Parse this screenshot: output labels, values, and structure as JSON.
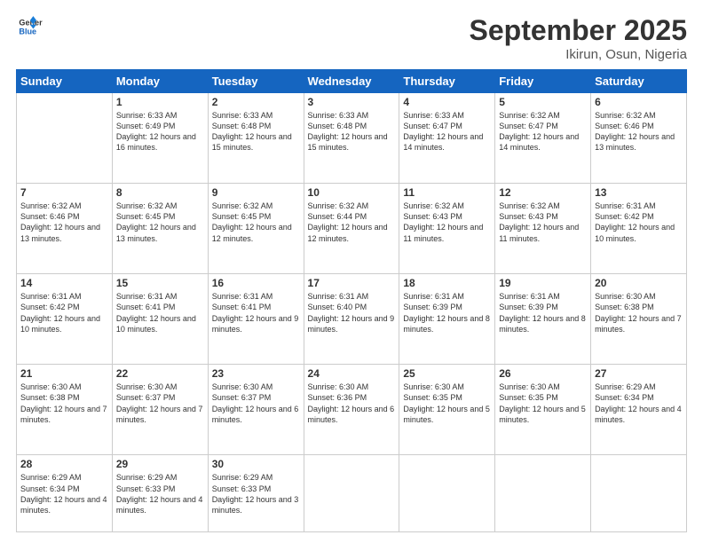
{
  "header": {
    "logo": {
      "line1": "General",
      "line2": "Blue"
    },
    "title": "September 2025",
    "location": "Ikirun, Osun, Nigeria"
  },
  "columns": [
    "Sunday",
    "Monday",
    "Tuesday",
    "Wednesday",
    "Thursday",
    "Friday",
    "Saturday"
  ],
  "weeks": [
    [
      {
        "day": "",
        "sunrise": "",
        "sunset": "",
        "daylight": ""
      },
      {
        "day": "1",
        "sunrise": "Sunrise: 6:33 AM",
        "sunset": "Sunset: 6:49 PM",
        "daylight": "Daylight: 12 hours and 16 minutes."
      },
      {
        "day": "2",
        "sunrise": "Sunrise: 6:33 AM",
        "sunset": "Sunset: 6:48 PM",
        "daylight": "Daylight: 12 hours and 15 minutes."
      },
      {
        "day": "3",
        "sunrise": "Sunrise: 6:33 AM",
        "sunset": "Sunset: 6:48 PM",
        "daylight": "Daylight: 12 hours and 15 minutes."
      },
      {
        "day": "4",
        "sunrise": "Sunrise: 6:33 AM",
        "sunset": "Sunset: 6:47 PM",
        "daylight": "Daylight: 12 hours and 14 minutes."
      },
      {
        "day": "5",
        "sunrise": "Sunrise: 6:32 AM",
        "sunset": "Sunset: 6:47 PM",
        "daylight": "Daylight: 12 hours and 14 minutes."
      },
      {
        "day": "6",
        "sunrise": "Sunrise: 6:32 AM",
        "sunset": "Sunset: 6:46 PM",
        "daylight": "Daylight: 12 hours and 13 minutes."
      }
    ],
    [
      {
        "day": "7",
        "sunrise": "Sunrise: 6:32 AM",
        "sunset": "Sunset: 6:46 PM",
        "daylight": "Daylight: 12 hours and 13 minutes."
      },
      {
        "day": "8",
        "sunrise": "Sunrise: 6:32 AM",
        "sunset": "Sunset: 6:45 PM",
        "daylight": "Daylight: 12 hours and 13 minutes."
      },
      {
        "day": "9",
        "sunrise": "Sunrise: 6:32 AM",
        "sunset": "Sunset: 6:45 PM",
        "daylight": "Daylight: 12 hours and 12 minutes."
      },
      {
        "day": "10",
        "sunrise": "Sunrise: 6:32 AM",
        "sunset": "Sunset: 6:44 PM",
        "daylight": "Daylight: 12 hours and 12 minutes."
      },
      {
        "day": "11",
        "sunrise": "Sunrise: 6:32 AM",
        "sunset": "Sunset: 6:43 PM",
        "daylight": "Daylight: 12 hours and 11 minutes."
      },
      {
        "day": "12",
        "sunrise": "Sunrise: 6:32 AM",
        "sunset": "Sunset: 6:43 PM",
        "daylight": "Daylight: 12 hours and 11 minutes."
      },
      {
        "day": "13",
        "sunrise": "Sunrise: 6:31 AM",
        "sunset": "Sunset: 6:42 PM",
        "daylight": "Daylight: 12 hours and 10 minutes."
      }
    ],
    [
      {
        "day": "14",
        "sunrise": "Sunrise: 6:31 AM",
        "sunset": "Sunset: 6:42 PM",
        "daylight": "Daylight: 12 hours and 10 minutes."
      },
      {
        "day": "15",
        "sunrise": "Sunrise: 6:31 AM",
        "sunset": "Sunset: 6:41 PM",
        "daylight": "Daylight: 12 hours and 10 minutes."
      },
      {
        "day": "16",
        "sunrise": "Sunrise: 6:31 AM",
        "sunset": "Sunset: 6:41 PM",
        "daylight": "Daylight: 12 hours and 9 minutes."
      },
      {
        "day": "17",
        "sunrise": "Sunrise: 6:31 AM",
        "sunset": "Sunset: 6:40 PM",
        "daylight": "Daylight: 12 hours and 9 minutes."
      },
      {
        "day": "18",
        "sunrise": "Sunrise: 6:31 AM",
        "sunset": "Sunset: 6:39 PM",
        "daylight": "Daylight: 12 hours and 8 minutes."
      },
      {
        "day": "19",
        "sunrise": "Sunrise: 6:31 AM",
        "sunset": "Sunset: 6:39 PM",
        "daylight": "Daylight: 12 hours and 8 minutes."
      },
      {
        "day": "20",
        "sunrise": "Sunrise: 6:30 AM",
        "sunset": "Sunset: 6:38 PM",
        "daylight": "Daylight: 12 hours and 7 minutes."
      }
    ],
    [
      {
        "day": "21",
        "sunrise": "Sunrise: 6:30 AM",
        "sunset": "Sunset: 6:38 PM",
        "daylight": "Daylight: 12 hours and 7 minutes."
      },
      {
        "day": "22",
        "sunrise": "Sunrise: 6:30 AM",
        "sunset": "Sunset: 6:37 PM",
        "daylight": "Daylight: 12 hours and 7 minutes."
      },
      {
        "day": "23",
        "sunrise": "Sunrise: 6:30 AM",
        "sunset": "Sunset: 6:37 PM",
        "daylight": "Daylight: 12 hours and 6 minutes."
      },
      {
        "day": "24",
        "sunrise": "Sunrise: 6:30 AM",
        "sunset": "Sunset: 6:36 PM",
        "daylight": "Daylight: 12 hours and 6 minutes."
      },
      {
        "day": "25",
        "sunrise": "Sunrise: 6:30 AM",
        "sunset": "Sunset: 6:35 PM",
        "daylight": "Daylight: 12 hours and 5 minutes."
      },
      {
        "day": "26",
        "sunrise": "Sunrise: 6:30 AM",
        "sunset": "Sunset: 6:35 PM",
        "daylight": "Daylight: 12 hours and 5 minutes."
      },
      {
        "day": "27",
        "sunrise": "Sunrise: 6:29 AM",
        "sunset": "Sunset: 6:34 PM",
        "daylight": "Daylight: 12 hours and 4 minutes."
      }
    ],
    [
      {
        "day": "28",
        "sunrise": "Sunrise: 6:29 AM",
        "sunset": "Sunset: 6:34 PM",
        "daylight": "Daylight: 12 hours and 4 minutes."
      },
      {
        "day": "29",
        "sunrise": "Sunrise: 6:29 AM",
        "sunset": "Sunset: 6:33 PM",
        "daylight": "Daylight: 12 hours and 4 minutes."
      },
      {
        "day": "30",
        "sunrise": "Sunrise: 6:29 AM",
        "sunset": "Sunset: 6:33 PM",
        "daylight": "Daylight: 12 hours and 3 minutes."
      },
      {
        "day": "",
        "sunrise": "",
        "sunset": "",
        "daylight": ""
      },
      {
        "day": "",
        "sunrise": "",
        "sunset": "",
        "daylight": ""
      },
      {
        "day": "",
        "sunrise": "",
        "sunset": "",
        "daylight": ""
      },
      {
        "day": "",
        "sunrise": "",
        "sunset": "",
        "daylight": ""
      }
    ]
  ]
}
